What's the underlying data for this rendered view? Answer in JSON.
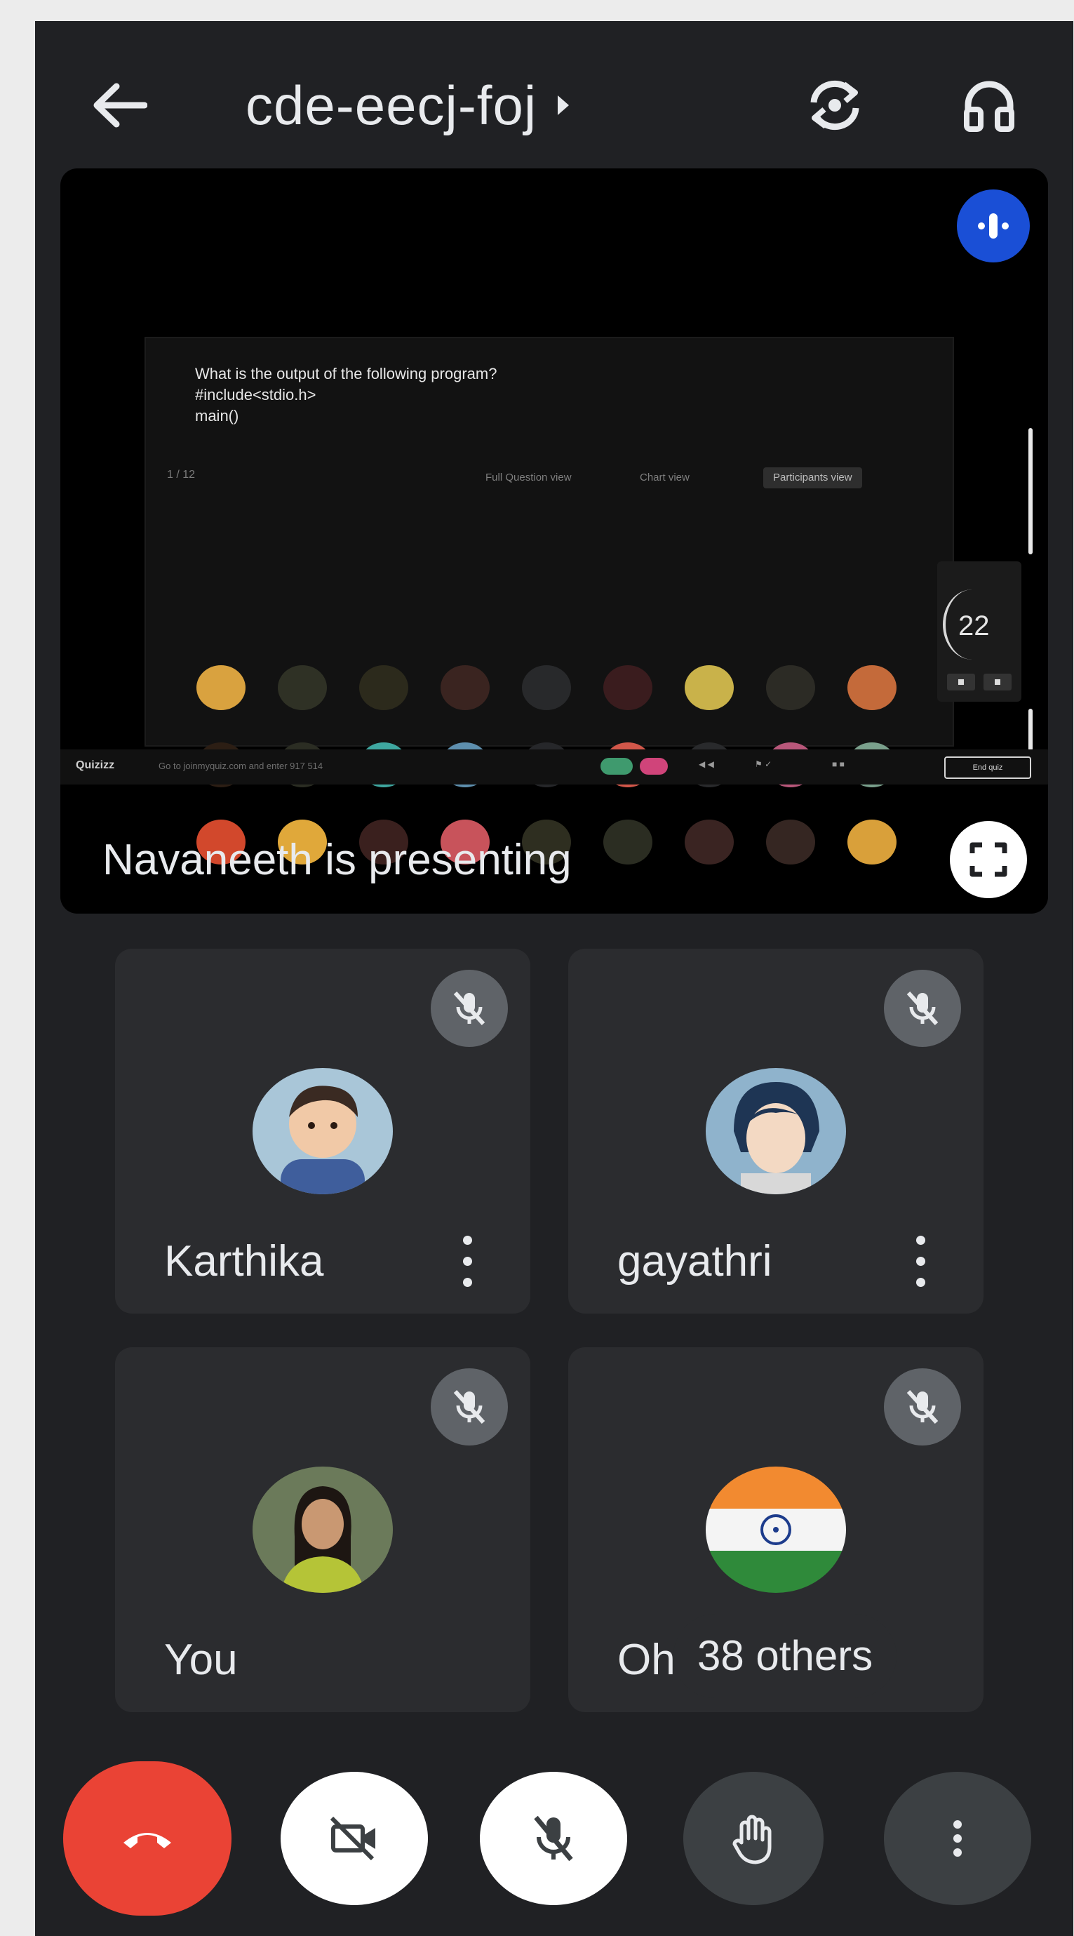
{
  "header": {
    "meeting_code": "cde-eecj-foj"
  },
  "presentation": {
    "presenting_label": "Navaneeth is presenting",
    "quiz": {
      "question": "What is the output of the following program?\n#include<stdio.h>\nmain()",
      "counter": "1 / 12",
      "tabs": [
        "Full Question view",
        "Chart view",
        "Participants view"
      ],
      "active_tab": "Participants view",
      "timer_value": "22",
      "brand": "Quizizz",
      "join_text": "Go to joinmyquiz.com and enter 917 514",
      "end_label": "End quiz"
    }
  },
  "participants": [
    {
      "name": "Karthika",
      "muted": true,
      "avatar": "child-photo"
    },
    {
      "name": "gayathri",
      "muted": true,
      "avatar": "anime-boy"
    },
    {
      "name": "You",
      "muted": true,
      "avatar": "woman-photo"
    },
    {
      "name": "Oh",
      "muted": true,
      "avatar": "india-flag",
      "others_label": "38 others"
    }
  ],
  "controls": {
    "end_call": "end-call",
    "camera": "camera-off",
    "mic": "mic-off",
    "raise_hand": "raise-hand",
    "more": "more-options"
  },
  "colors": {
    "background": "#202124",
    "tile": "#2b2c2f",
    "end_call": "#ea4335",
    "speaking": "#1a4fd6"
  }
}
